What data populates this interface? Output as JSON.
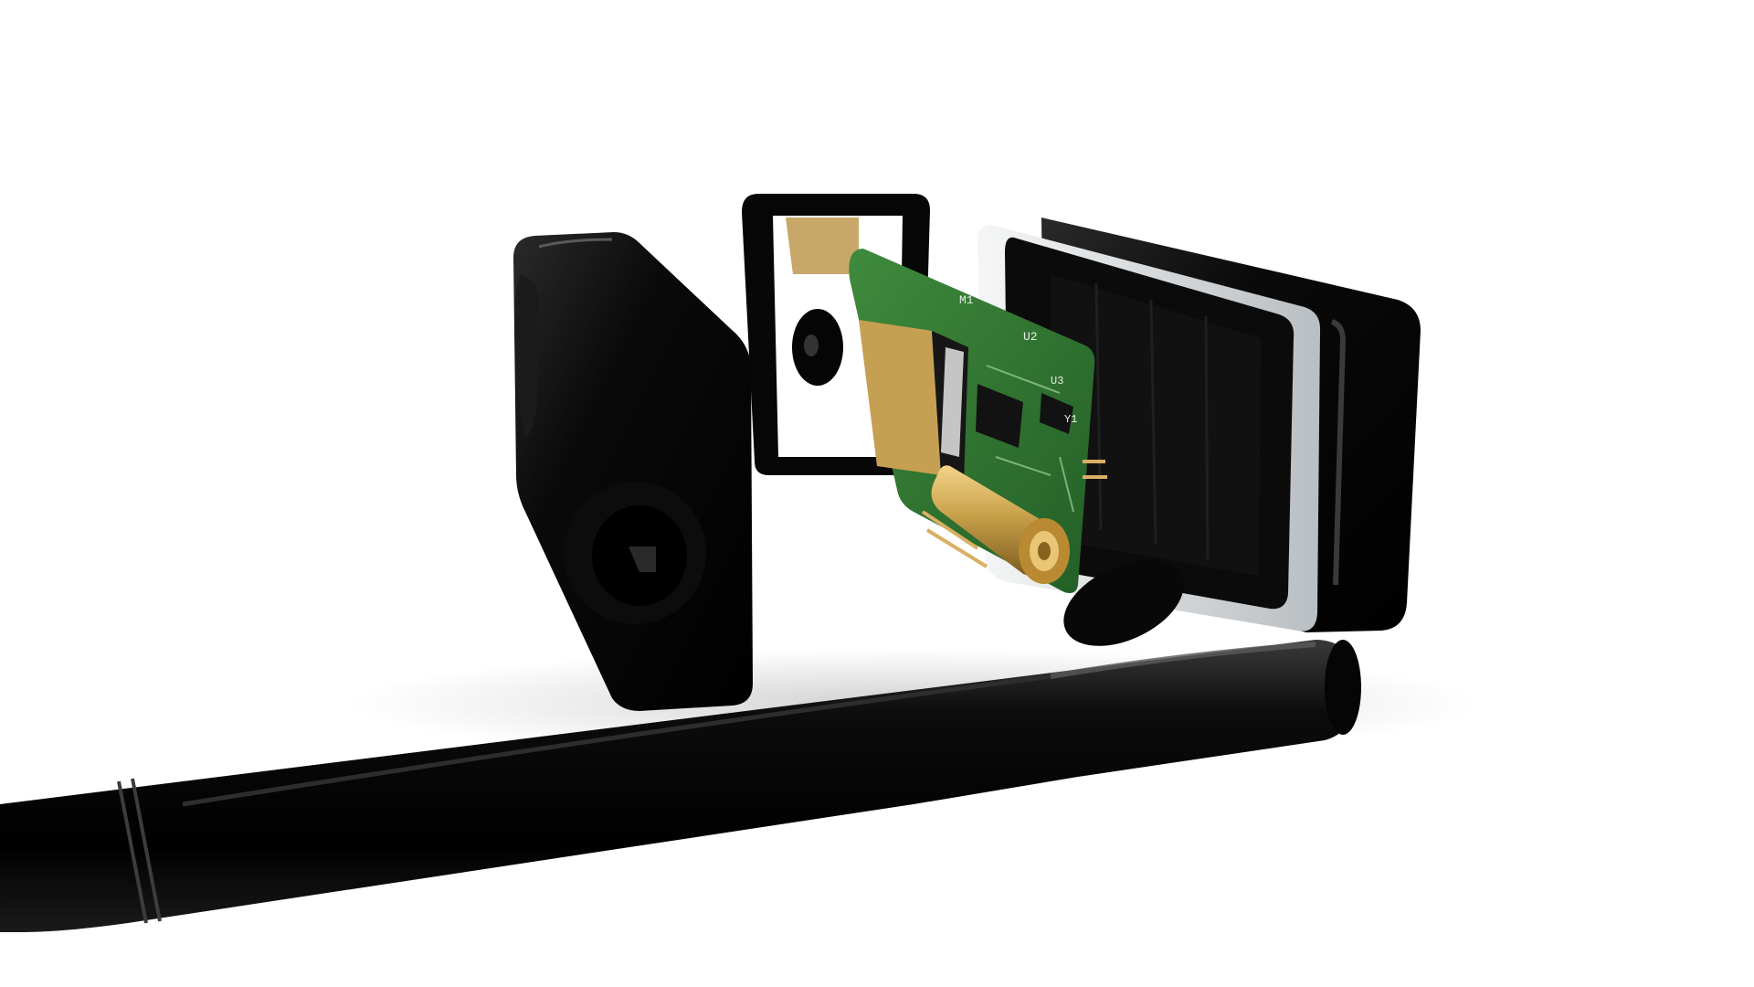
{
  "scene": {
    "subject": "exploded-render-usb-radio-dongle",
    "colors": {
      "background": "#ffffff",
      "enclosure": "#050505",
      "pcb": "#2f7a32",
      "gold": "#c9a04a",
      "gasket": "#d9dde0"
    },
    "pcb_silkscreen": {
      "m1": "M1",
      "u2": "U2",
      "u3": "U3",
      "y1": "Y1"
    }
  }
}
